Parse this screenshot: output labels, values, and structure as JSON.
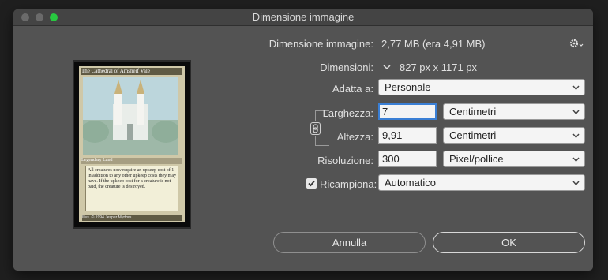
{
  "window": {
    "title": "Dimensione immagine"
  },
  "info": {
    "size_label": "Dimensione immagine:",
    "size_value": "2,77 MB (era 4,91 MB)",
    "dimensions_label": "Dimensioni:",
    "dimensions_value": "827 px x 1171 px"
  },
  "fit": {
    "label": "Adatta a:",
    "value": "Personale"
  },
  "width": {
    "label": "Larghezza:",
    "value": "7",
    "unit": "Centimetri"
  },
  "height": {
    "label": "Altezza:",
    "value": "9,91",
    "unit": "Centimetri"
  },
  "resolution": {
    "label": "Risoluzione:",
    "value": "300",
    "unit": "Pixel/pollice"
  },
  "resample": {
    "label": "Ricampiona:",
    "checked": true,
    "value": "Automatico"
  },
  "buttons": {
    "cancel": "Annulla",
    "ok": "OK"
  },
  "preview": {
    "card_title": "The Cathedral of Amsheif Vale",
    "card_type": "Legendary Land",
    "card_text": "All creatures now require an upkeep cost of 1 in addition to any other upkeep costs they may have. If the upkeep cost for a creature is not paid, the creature is destroyed.",
    "card_footer": "Illus. © 1994 Jesper Myrfors"
  },
  "colors": {
    "dialog_bg": "#535353",
    "focus": "#3a7fd5",
    "zoom_light": "#28c840"
  },
  "icons": [
    "gear-icon",
    "chevron-down-icon",
    "chain-link-icon",
    "checkmark-icon"
  ]
}
